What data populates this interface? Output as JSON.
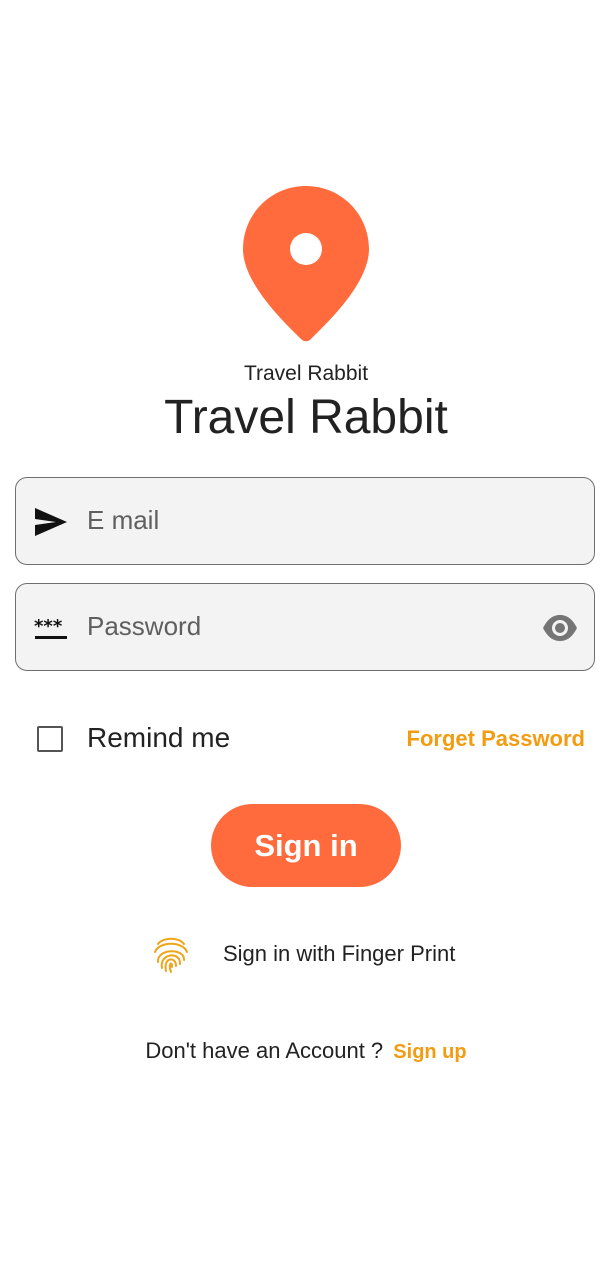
{
  "app": {
    "brand_small": "Travel Rabbit",
    "brand_large": "Travel Rabbit",
    "logo_icon": "map-pin-icon"
  },
  "form": {
    "email_placeholder": "E mail",
    "email_icon": "send-icon",
    "password_placeholder": "Password",
    "password_icon": "password-dots-icon",
    "visibility_icon": "eye-icon",
    "remember_label": "Remind me",
    "remember_checked": false,
    "forgot_label": "Forget Password",
    "signin_label": "Sign in",
    "fingerprint_label": "Sign in with Finger Print",
    "fingerprint_icon": "fingerprint-icon",
    "no_account_text": "Don't have an Account ?",
    "signup_label": "Sign up"
  },
  "colors": {
    "accent": "#ff6b3d",
    "link": "#f39c12",
    "field_bg": "#f3f3f3",
    "field_border": "#6f6f6f"
  }
}
